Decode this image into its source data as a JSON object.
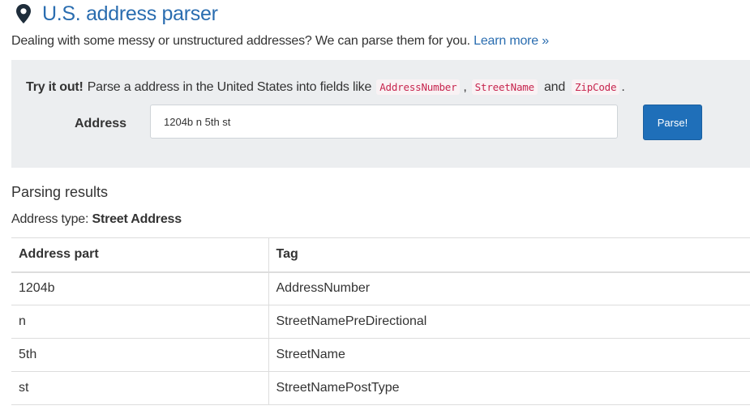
{
  "header": {
    "title": "U.S. address parser",
    "icon": "map-marker-icon"
  },
  "intro": {
    "text": "Dealing with some messy or unstructured addresses? We can parse them for you.",
    "link_label": "Learn more »"
  },
  "try_it": {
    "bold_label": "Try it out!",
    "text": "Parse a address in the United States into fields like",
    "examples": [
      "AddressNumber",
      "StreetName",
      "ZipCode"
    ],
    "and_word": "and",
    "end_period": "."
  },
  "form": {
    "address_label": "Address",
    "address_value": "1204b n 5th st",
    "parse_button_label": "Parse!"
  },
  "results": {
    "heading": "Parsing results",
    "address_type_label": "Address type:",
    "address_type_value": "Street Address",
    "columns": [
      "Address part",
      "Tag"
    ],
    "rows": [
      [
        "1204b",
        "AddressNumber"
      ],
      [
        "n",
        "StreetNamePreDirectional"
      ],
      [
        "5th",
        "StreetName"
      ],
      [
        "st",
        "StreetNamePostType"
      ]
    ]
  },
  "colors": {
    "link": "#2a6db0",
    "button": "#1f6fb9",
    "panel": "#eceef0",
    "code": "#c7254e"
  }
}
